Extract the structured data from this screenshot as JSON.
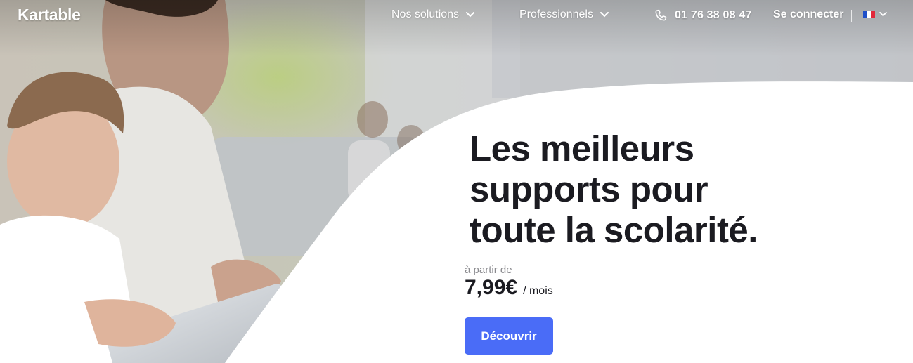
{
  "brand": {
    "name": "Kartable"
  },
  "nav": {
    "solutions_label": "Nos solutions",
    "pros_label": "Professionnels",
    "phone": "01 76 38 08 47",
    "login_label": "Se connecter",
    "language_flag": "flag-fr-icon"
  },
  "hero": {
    "headline_line1": "Les meilleurs",
    "headline_line2": "supports pour",
    "headline_line3": "toute la scolarité.",
    "price_prefix": "à partir de",
    "price_amount": "7,99€",
    "price_unit": "/ mois",
    "cta_label": "Découvrir"
  },
  "colors": {
    "accent": "#4a6cf7",
    "headline": "#1b1b21",
    "muted": "#8a8a8e",
    "flag_blue": "#1f4fc8",
    "flag_white": "#ffffff",
    "flag_red": "#e2283a"
  },
  "icons": {
    "phone": "phone-icon",
    "chevron": "chevron-down-icon"
  }
}
